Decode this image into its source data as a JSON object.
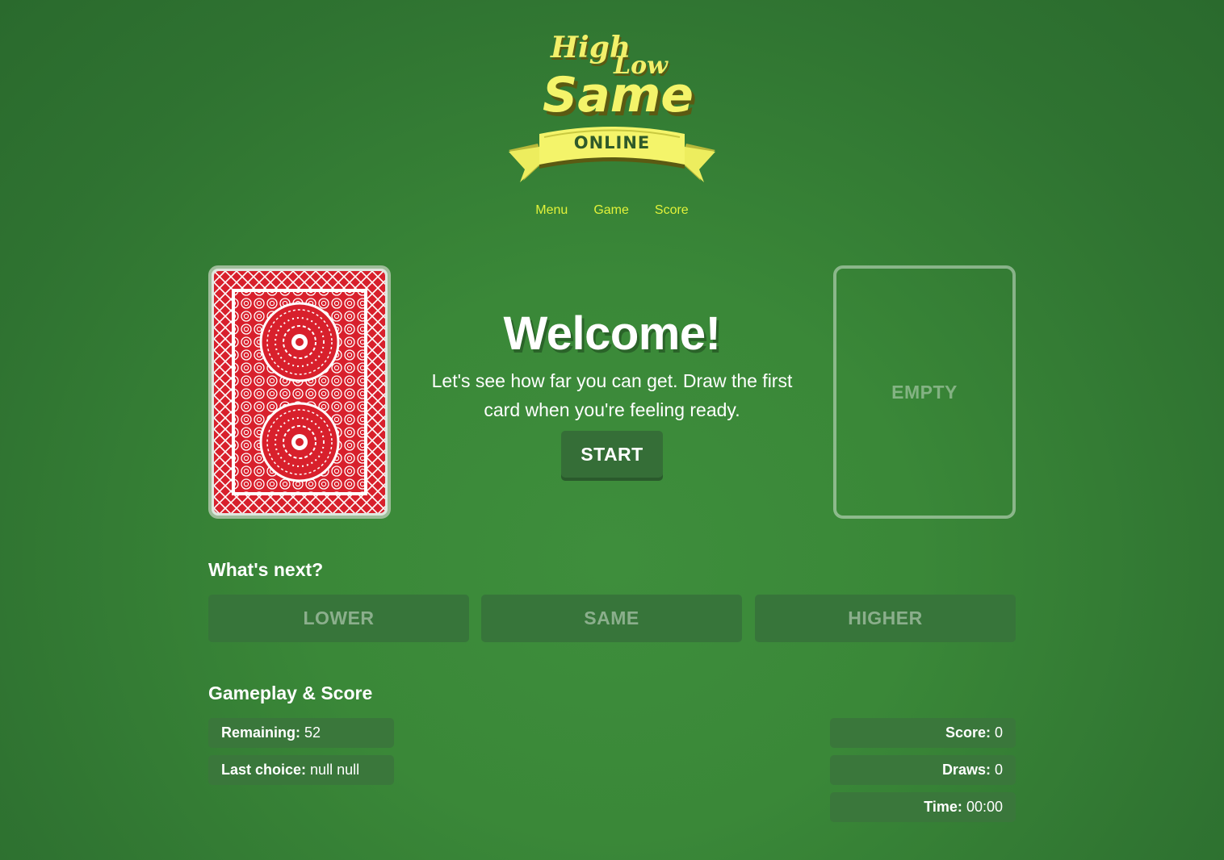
{
  "logo": {
    "line1": "High",
    "line2": "Low",
    "line3": "Same",
    "ribbon": "ONLINE"
  },
  "nav": {
    "menu": "Menu",
    "game": "Game",
    "score": "Score"
  },
  "welcome": {
    "title": "Welcome!",
    "text": "Let's see how far you can get. Draw the first card when you're feeling ready.",
    "start": "START"
  },
  "empty_card": {
    "label": "EMPTY"
  },
  "whats_next": {
    "title": "What's next?",
    "lower": "LOWER",
    "same": "SAME",
    "higher": "HIGHER"
  },
  "gameplay": {
    "title": "Gameplay & Score",
    "remaining_label": "Remaining:",
    "remaining_value": "52",
    "last_choice_label": "Last choice:",
    "last_choice_value": "null null",
    "score_label": "Score:",
    "score_value": "0",
    "draws_label": "Draws:",
    "draws_value": "0",
    "time_label": "Time:",
    "time_value": "00:00"
  },
  "colors": {
    "background": "#3a8838",
    "nav_link": "#e2f23a",
    "card_red": "#d8202c",
    "logo_yellow": "#f4f46a"
  }
}
